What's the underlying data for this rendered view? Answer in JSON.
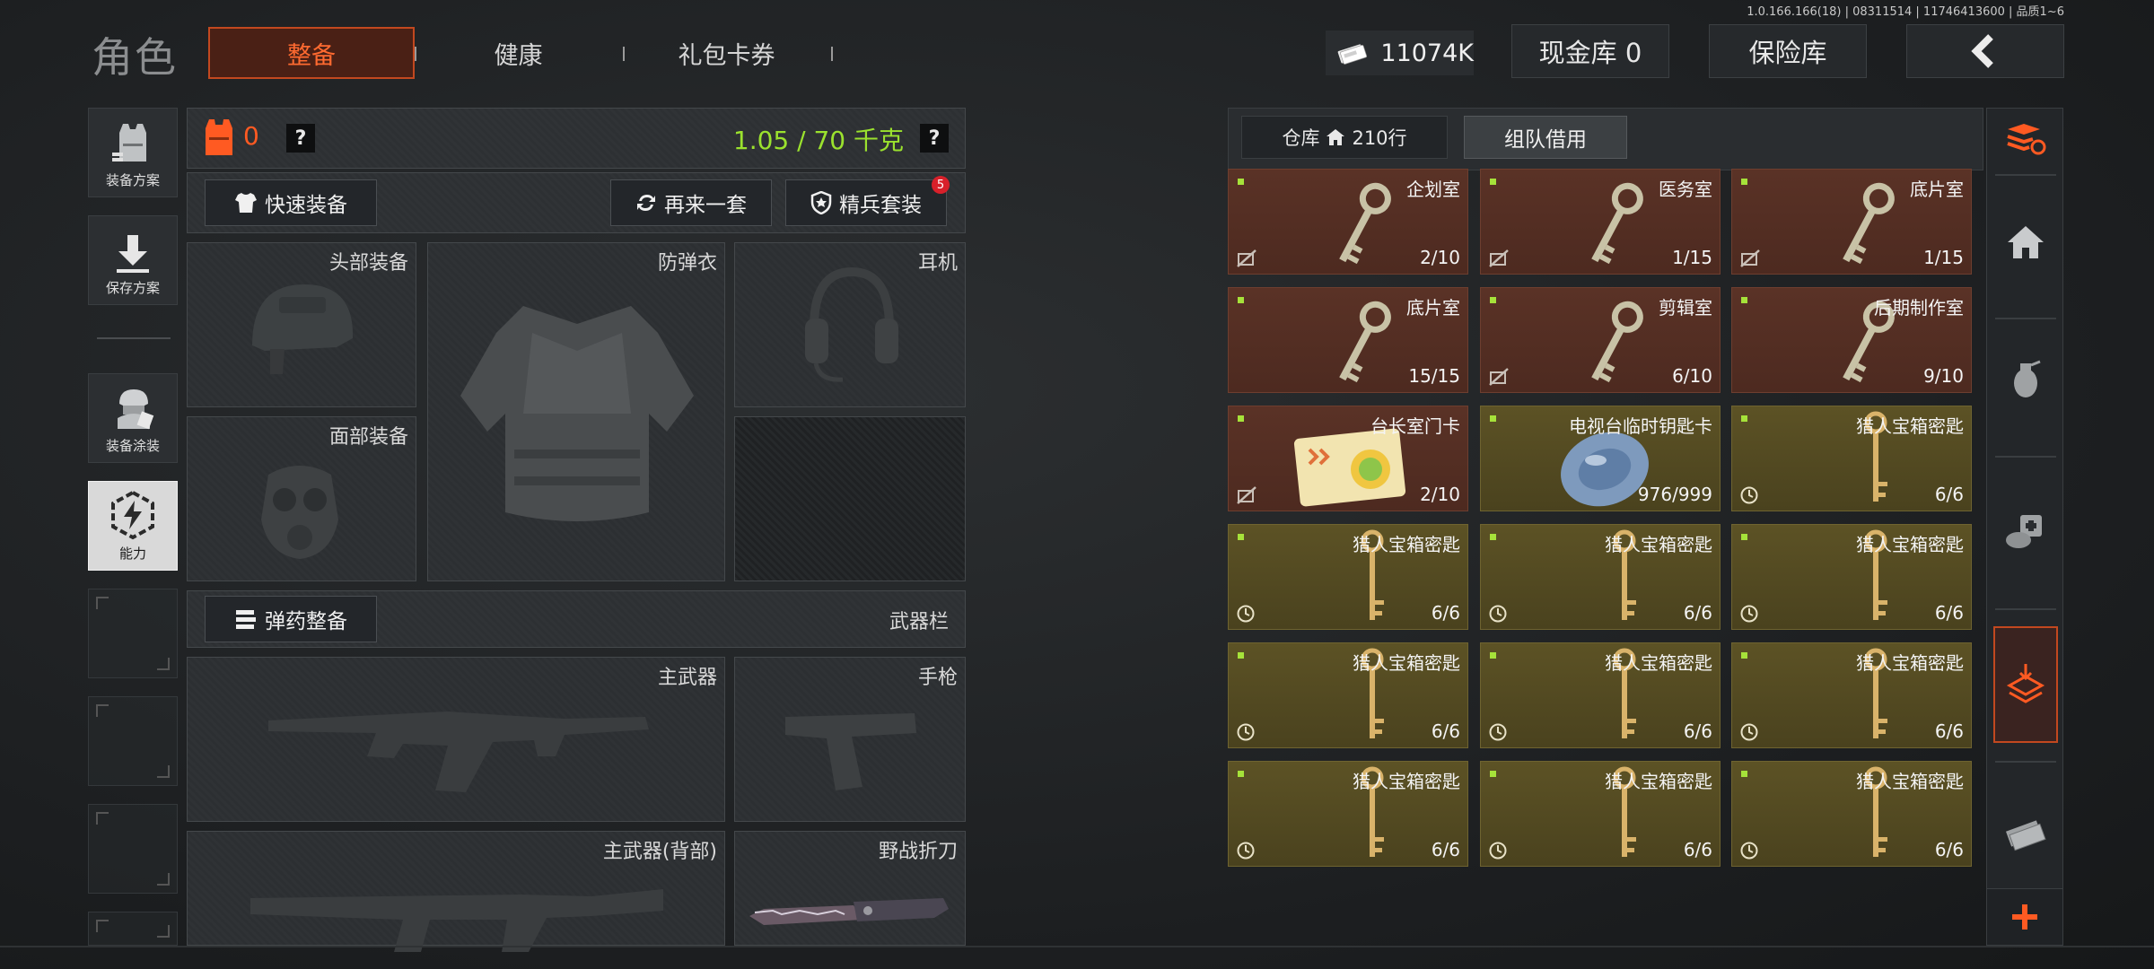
{
  "version": "1.0.166.166(18) | 08311514 | 11746413600 | 品质1~6",
  "header": {
    "title": "角色",
    "tabs": [
      "整备",
      "健康",
      "礼包卡券"
    ],
    "money": "11074K",
    "cash_vault": "现金库 0",
    "insurance": "保险库"
  },
  "sidebar": {
    "items": [
      {
        "label": "装备方案",
        "icon": "vest-plan-icon"
      },
      {
        "label": "保存方案",
        "icon": "download-icon"
      },
      {
        "label": "装备涂装",
        "icon": "soldier-paint-icon"
      },
      {
        "label": "能力",
        "icon": "lightning-hex-icon"
      }
    ]
  },
  "loadout": {
    "armor_count": "0",
    "weight": "1.05 / 70 千克",
    "quick_equip": "快速装备",
    "again_set": "再来一套",
    "elite_set": "精兵套装",
    "elite_badge": "5",
    "slots": {
      "head": "头部装备",
      "armor": "防弹衣",
      "headset": "耳机",
      "face": "面部装备",
      "primary": "主武器",
      "pistol": "手枪",
      "primary_back": "主武器(背部)",
      "knife": "野战折刀"
    },
    "ammo_btn": "弹药整备",
    "weapon_bar": "武器栏"
  },
  "storage": {
    "tab_warehouse": "仓库",
    "warehouse_rows": "210行",
    "tab_team": "组队借用",
    "items": [
      {
        "name": "企划室",
        "count": "2/10",
        "kind": "key",
        "bg": "red",
        "corner": "no-icon"
      },
      {
        "name": "医务室",
        "count": "1/15",
        "kind": "key",
        "bg": "red",
        "corner": "no-icon"
      },
      {
        "name": "底片室",
        "count": "1/15",
        "kind": "key",
        "bg": "red",
        "corner": "no-icon"
      },
      {
        "name": "底片室",
        "count": "15/15",
        "kind": "key",
        "bg": "red",
        "corner": ""
      },
      {
        "name": "剪辑室",
        "count": "6/10",
        "kind": "key",
        "bg": "red",
        "corner": "no-icon"
      },
      {
        "name": "后期制作室",
        "count": "9/10",
        "kind": "key",
        "bg": "red",
        "corner": ""
      },
      {
        "name": "台长室门卡",
        "count": "2/10",
        "kind": "card",
        "bg": "red",
        "corner": "no-icon"
      },
      {
        "name": "电视台临时钥匙卡",
        "count": "976/999",
        "kind": "disc",
        "bg": "gold",
        "corner": ""
      },
      {
        "name": "猎人宝箱密匙",
        "count": "6/6",
        "kind": "goldkey",
        "bg": "gold",
        "corner": "clock-icon"
      },
      {
        "name": "猎人宝箱密匙",
        "count": "6/6",
        "kind": "goldkey",
        "bg": "gold",
        "corner": "clock-icon"
      },
      {
        "name": "猎人宝箱密匙",
        "count": "6/6",
        "kind": "goldkey",
        "bg": "gold",
        "corner": "clock-icon"
      },
      {
        "name": "猎人宝箱密匙",
        "count": "6/6",
        "kind": "goldkey",
        "bg": "gold",
        "corner": "clock-icon"
      },
      {
        "name": "猎人宝箱密匙",
        "count": "6/6",
        "kind": "goldkey",
        "bg": "gold",
        "corner": "clock-icon"
      },
      {
        "name": "猎人宝箱密匙",
        "count": "6/6",
        "kind": "goldkey",
        "bg": "gold",
        "corner": "clock-icon"
      },
      {
        "name": "猎人宝箱密匙",
        "count": "6/6",
        "kind": "goldkey",
        "bg": "gold",
        "corner": "clock-icon"
      },
      {
        "name": "猎人宝箱密匙",
        "count": "6/6",
        "kind": "goldkey",
        "bg": "gold",
        "corner": "clock-icon"
      },
      {
        "name": "猎人宝箱密匙",
        "count": "6/6",
        "kind": "goldkey",
        "bg": "gold",
        "corner": "clock-icon"
      },
      {
        "name": "猎人宝箱密匙",
        "count": "6/6",
        "kind": "goldkey",
        "bg": "gold",
        "corner": "clock-icon"
      }
    ]
  },
  "rail": {
    "icons": [
      "stack-refresh-icon",
      "home-icon",
      "grenade-icon",
      "meds-icon",
      "quick-pick-icon",
      "cash-icon",
      "plus-icon"
    ]
  },
  "colors": {
    "accent": "#ff5a22",
    "weight_green": "#9be22e",
    "badge_red": "#d8202a"
  }
}
